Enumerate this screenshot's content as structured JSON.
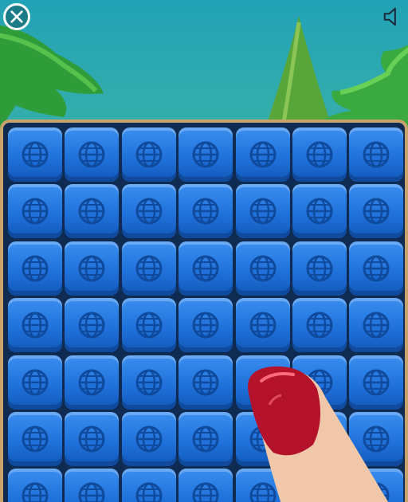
{
  "game": {
    "board": {
      "rows": 7,
      "cols": 7,
      "tile_type": "globe-cube"
    },
    "colors": {
      "sky_top": "#22a2b6",
      "tile_blue": "#1e6fd9",
      "board_frame": "#c8a46c",
      "nail": "#b3122a"
    },
    "controls": {
      "close_icon": "close-icon",
      "sound_icon": "speaker-icon"
    }
  }
}
